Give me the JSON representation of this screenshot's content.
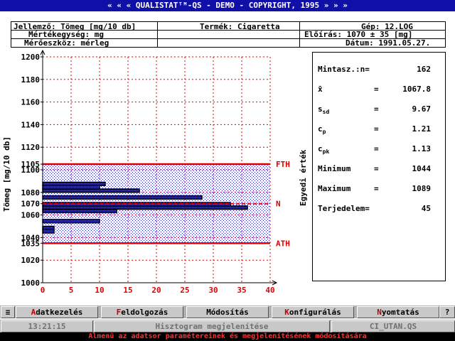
{
  "window": {
    "title": "« « « QUALISTATᵀᴹ-QS - DEMO - COPYRIGHT, 1995 » » »"
  },
  "info": {
    "jellemzo": "Jellemző: Tömeg [mg/10 db]",
    "termek": "Termék: Cigaretta",
    "gep": "Gép: 12.LOG",
    "mertekegyseg": "Mértékegység: mg",
    "eloiras": "Előírás: 1070 ± 35 [mg]",
    "meroeszkoz": "Mérőeszköz: mérleg",
    "datum": "Dátum: 1991.05.27."
  },
  "chart_data": {
    "type": "bar",
    "orientation": "horizontal",
    "ylabel": "Tömeg [mg/10 db]",
    "xlabel": "",
    "xlim": [
      0,
      40
    ],
    "ylim": [
      1000,
      1200
    ],
    "x_ticks": [
      0,
      5,
      10,
      15,
      20,
      25,
      30,
      35,
      40
    ],
    "y_ticks": [
      1000,
      1020,
      1035,
      1040,
      1060,
      1070,
      1080,
      1100,
      1105,
      1120,
      1140,
      1160,
      1180,
      1200
    ],
    "grid": true,
    "bins": [
      {
        "from": 1086,
        "to": 1089,
        "count": 11
      },
      {
        "from": 1083,
        "to": 1086,
        "count": 10
      },
      {
        "from": 1080,
        "to": 1083,
        "count": 17
      },
      {
        "from": 1074,
        "to": 1077,
        "count": 28
      },
      {
        "from": 1068,
        "to": 1071,
        "count": 33
      },
      {
        "from": 1065,
        "to": 1068,
        "count": 36
      },
      {
        "from": 1062,
        "to": 1065,
        "count": 13
      },
      {
        "from": 1053,
        "to": 1056,
        "count": 10
      },
      {
        "from": 1047,
        "to": 1050,
        "count": 2
      },
      {
        "from": 1044,
        "to": 1047,
        "count": 2
      }
    ],
    "limits": [
      {
        "label": "FTH",
        "value": 1105
      },
      {
        "label": "N",
        "value": 1070
      },
      {
        "label": "ATH",
        "value": 1035
      }
    ],
    "side_label": "Egyedi érték",
    "colors": {
      "bar_fill": "#1010a8",
      "bar_border": "#000000",
      "limit": "#e00000",
      "grid": "#e00000",
      "band_dots": "#1010a8"
    }
  },
  "stats": {
    "rows": [
      {
        "label": "Mintasz.:n=",
        "eq": "",
        "value": "162"
      },
      {
        "label": "x̄",
        "eq": "=",
        "value": "1067.8"
      },
      {
        "label": "s",
        "sub": "sd",
        "eq": "=",
        "value": "9.67"
      },
      {
        "label": "c",
        "sub": "p",
        "eq": "=",
        "value": "1.21"
      },
      {
        "label": "c",
        "sub": "pk",
        "eq": "=",
        "value": "1.13"
      },
      {
        "label": "Minimum",
        "eq": "=",
        "value": "1044"
      },
      {
        "label": "Maximum",
        "eq": "=",
        "value": "1089"
      },
      {
        "label": "Terjedelem=",
        "eq": "",
        "value": "45"
      }
    ]
  },
  "menu": {
    "sys": "≡",
    "help": "?",
    "items": [
      {
        "hotkey": "A",
        "rest": "datkezelés"
      },
      {
        "hotkey": "F",
        "rest": "eldolgozás"
      },
      {
        "hotkey": "",
        "rest": "Módosítás"
      },
      {
        "hotkey": "K",
        "rest": "onfigurálás"
      },
      {
        "hotkey": "N",
        "rest": "yomtatás"
      }
    ]
  },
  "status": {
    "time": "13:21:15",
    "mode": "Hisztogram megjelenítése",
    "file": "CI_UTAN.QS"
  },
  "hint": "Almenü az adatsor paramétereinek és megjelenítésének módosítására"
}
